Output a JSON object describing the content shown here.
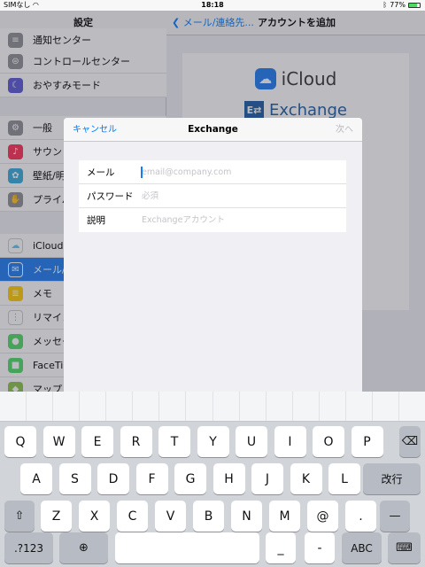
{
  "status_bar": {
    "carrier": "SIMなし",
    "time": "18:18",
    "battery": "77%",
    "battery_level": 0.77
  },
  "settings": {
    "title": "設定",
    "items": [
      {
        "label": "通知センター",
        "icon": "notification-icon",
        "color": "#8e8e93"
      },
      {
        "label": "コントロールセンター",
        "icon": "control-center-icon",
        "color": "#8e8e93"
      },
      {
        "label": "おやすみモード",
        "icon": "moon-icon",
        "color": "#5856d6"
      },
      {
        "label": "一般",
        "icon": "gear-icon",
        "color": "#8e8e93"
      },
      {
        "label": "サウン",
        "icon": "sound-icon",
        "color": "#ff2d55"
      },
      {
        "label": "壁紙/明",
        "icon": "wallpaper-icon",
        "color": "#34aadc"
      },
      {
        "label": "プライバ",
        "icon": "hand-icon",
        "color": "#8e8e93"
      },
      {
        "label": "iCloud",
        "icon": "cloud-icon",
        "color": "#ffffff"
      },
      {
        "label": "メール/",
        "icon": "mail-icon",
        "color": "#1a7af0"
      },
      {
        "label": "メモ",
        "icon": "notes-icon",
        "color": "#ffcc00"
      },
      {
        "label": "リマイン",
        "icon": "reminders-icon",
        "color": "#ffffff"
      },
      {
        "label": "メッセー",
        "icon": "messages-icon",
        "color": "#4cd964"
      },
      {
        "label": "FaceTim",
        "icon": "facetime-icon",
        "color": "#4cd964"
      },
      {
        "label": "マップ",
        "icon": "maps-icon",
        "color": "#8bc34a"
      }
    ]
  },
  "detail": {
    "back_label": "メール/連絡先...",
    "title": "アカウントを追加",
    "providers": {
      "icloud": "iCloud",
      "exchange": "Exchange"
    }
  },
  "modal": {
    "cancel": "キャンセル",
    "title": "Exchange",
    "next": "次へ",
    "fields": [
      {
        "label": "メール",
        "placeholder": "email@company.com",
        "value": ""
      },
      {
        "label": "パスワード",
        "placeholder": "必須",
        "value": ""
      },
      {
        "label": "説明",
        "placeholder": "Exchangeアカウント",
        "value": ""
      }
    ]
  },
  "keyboard": {
    "row1": [
      "Q",
      "W",
      "E",
      "R",
      "T",
      "Y",
      "U",
      "I",
      "O",
      "P"
    ],
    "row2": [
      "A",
      "S",
      "D",
      "F",
      "G",
      "H",
      "J",
      "K",
      "L"
    ],
    "row3": [
      "Z",
      "X",
      "C",
      "V",
      "B",
      "N",
      "M",
      "@",
      "."
    ],
    "return_label": "改行",
    "numbers_label": ".?123",
    "underscore": "_",
    "dash_small": "-",
    "dash_wide": "—",
    "abc_label": "ABC",
    "backspace_icon": "backspace-icon",
    "shift_icon": "shift-icon",
    "globe_icon": "globe-icon",
    "hide_icon": "keyboard-hide-icon"
  }
}
